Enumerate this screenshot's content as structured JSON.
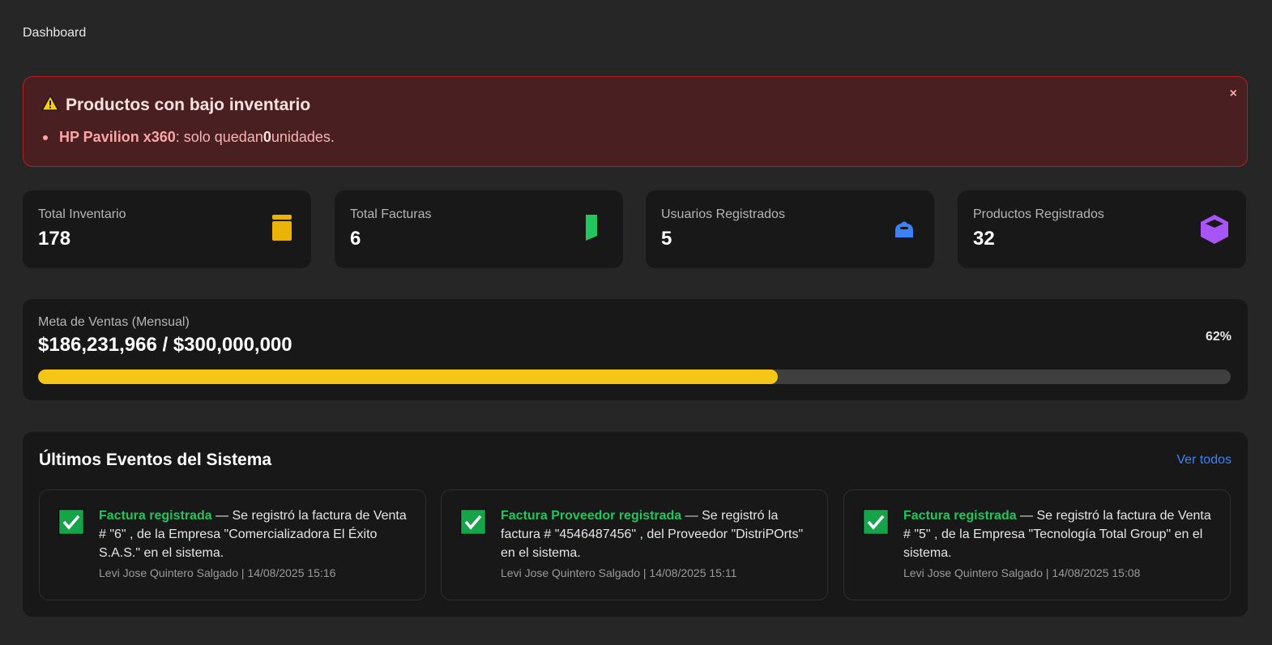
{
  "page": {
    "title": "Dashboard"
  },
  "alert": {
    "icon": "warning-icon",
    "title": "Productos con bajo inventario",
    "close_label": "×",
    "items": [
      {
        "product": "HP Pavilion x360",
        "text_before": ": solo quedan ",
        "quantity": "0",
        "text_after": " unidades."
      }
    ]
  },
  "stats": [
    {
      "label": "Total Inventario",
      "value": "178",
      "icon": "inventory-box-icon",
      "color": "#eab308"
    },
    {
      "label": "Total Facturas",
      "value": "6",
      "icon": "invoice-icon",
      "color": "#22c55e"
    },
    {
      "label": "Usuarios Registrados",
      "value": "5",
      "icon": "user-icon",
      "color": "#3b82f6"
    },
    {
      "label": "Productos Registrados",
      "value": "32",
      "icon": "cube-icon",
      "color": "#a855f7"
    }
  ],
  "sales_goal": {
    "label": "Meta de Ventas (Mensual)",
    "amount": "$186,231,966 / $300,000,000",
    "percent_label": "62%",
    "progress": 0.62,
    "bar_color": "#f5c518"
  },
  "events": {
    "title": "Últimos Eventos del Sistema",
    "view_all": "Ver todos",
    "items": [
      {
        "type": "Factura registrada",
        "description": " — Se registró la factura de Venta # \"6\" , de la Empresa \"Comercializadora El Éxito S.A.S.\" en el sistema.",
        "meta": "Levi Jose Quintero Salgado | 14/08/2025 15:16",
        "icon": "check-icon"
      },
      {
        "type": "Factura Proveedor registrada",
        "description": " — Se registró la factura # \"4546487456\" , del Proveedor \"DistriPOrts\" en el sistema.",
        "meta": "Levi Jose Quintero Salgado | 14/08/2025 15:11",
        "icon": "check-icon"
      },
      {
        "type": "Factura registrada",
        "description": " — Se registró la factura de Venta # \"5\" , de la Empresa \"Tecnología Total Group\" en el sistema.",
        "meta": "Levi Jose Quintero Salgado | 14/08/2025 15:08",
        "icon": "check-icon"
      }
    ]
  }
}
